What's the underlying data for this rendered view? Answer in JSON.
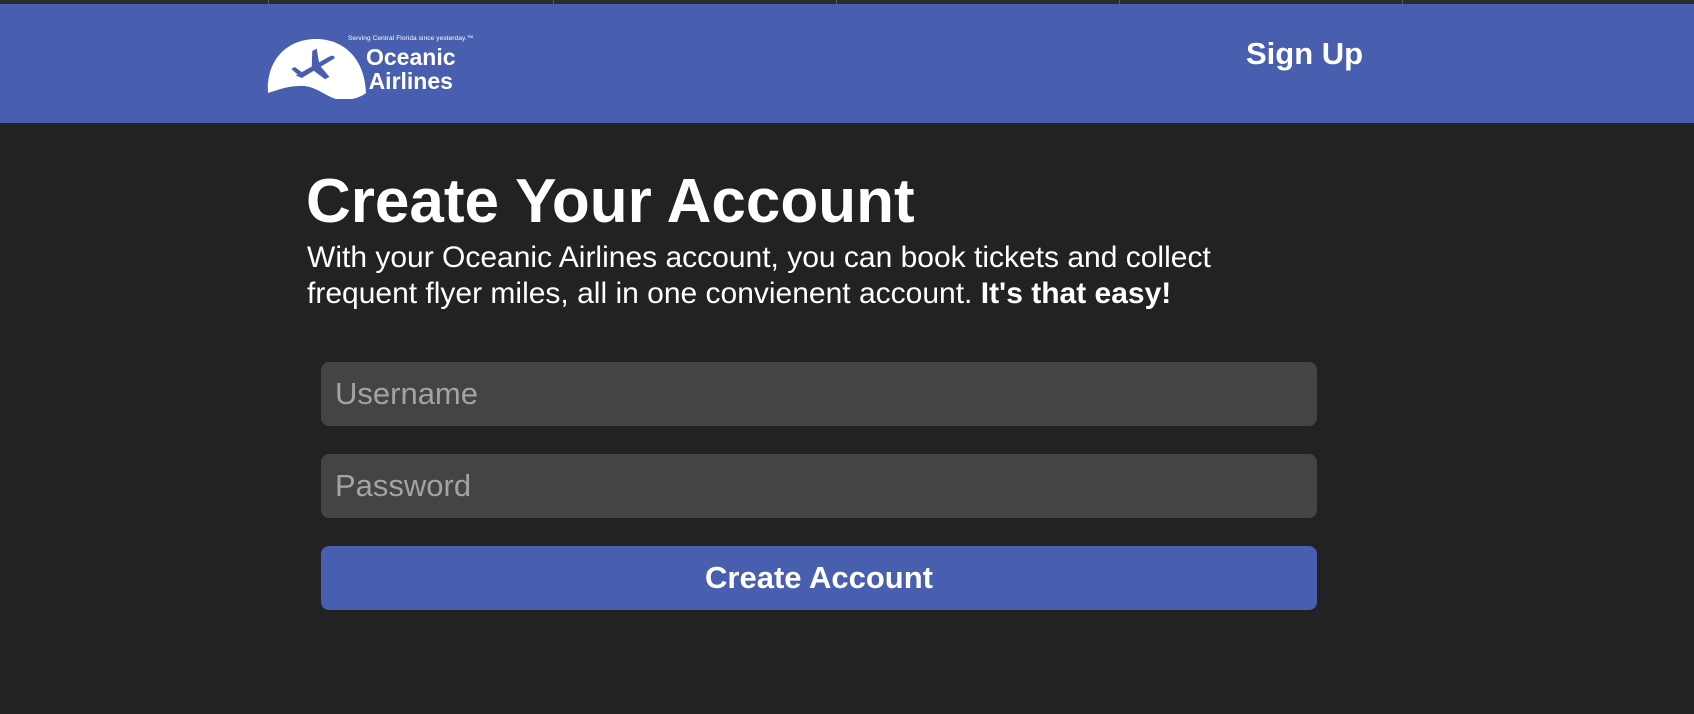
{
  "header": {
    "brand_name": "Oceanic\nAirlines",
    "tagline": "Serving Central Florida since yesterday.™",
    "signup_label": "Sign Up"
  },
  "main": {
    "title": "Create Your Account",
    "description": "With your Oceanic Airlines account, you can book tickets and collect frequent flyer miles, all in one convienent account.",
    "description_emphasis": "It's that easy!"
  },
  "form": {
    "username_placeholder": "Username",
    "password_placeholder": "Password",
    "submit_label": "Create Account"
  },
  "colors": {
    "brand": "#485fb0",
    "background": "#222222",
    "input_background": "#444444"
  }
}
